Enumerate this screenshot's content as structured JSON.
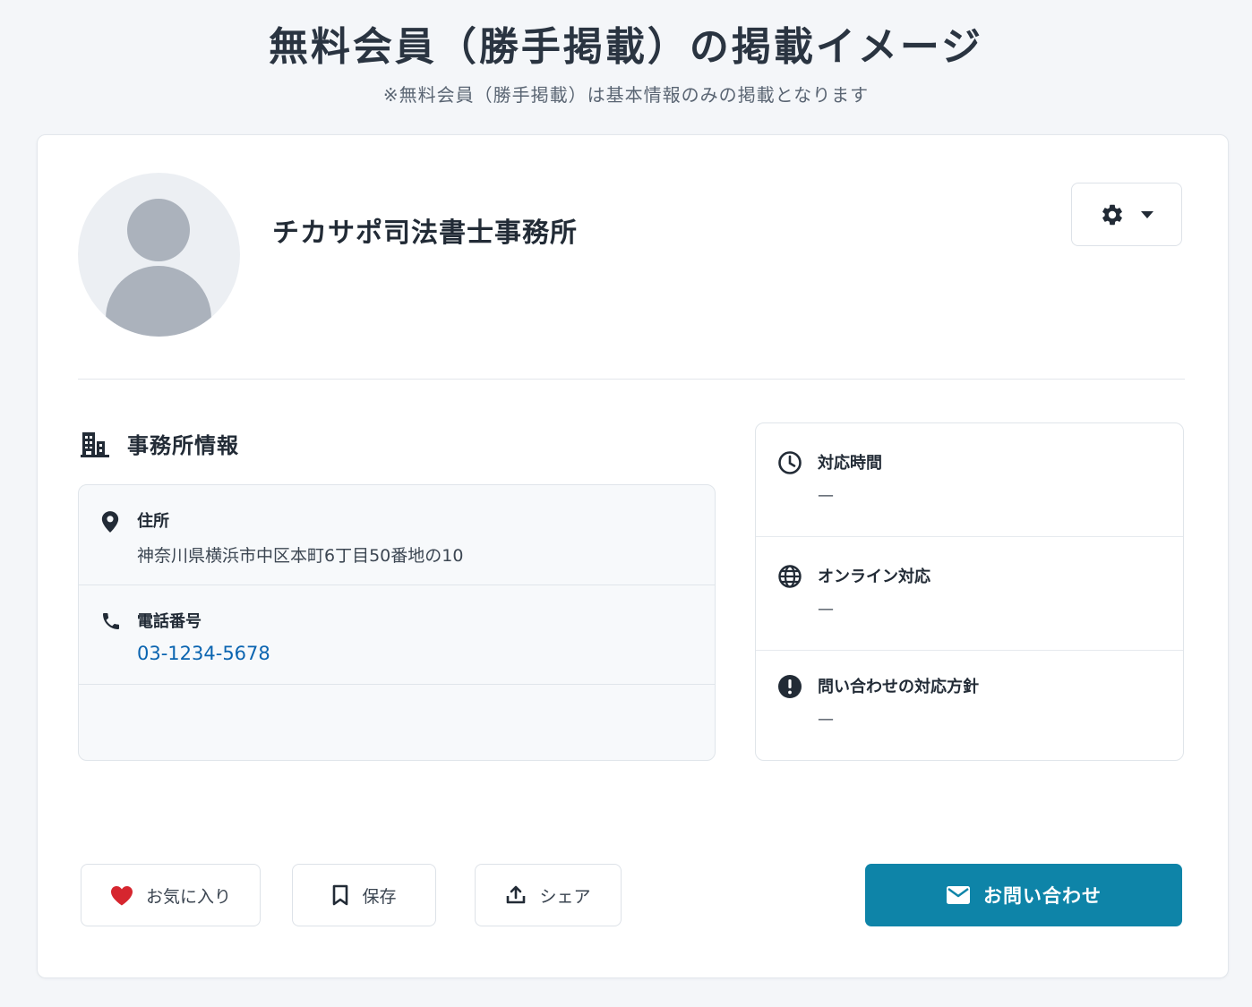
{
  "page": {
    "title": "無料会員（勝手掲載）の掲載イメージ",
    "subtitle": "※無料会員（勝手掲載）は基本情報のみの掲載となります"
  },
  "profile": {
    "office_name": "チカサポ司法書士事務所"
  },
  "office_info": {
    "section_title": "事務所情報",
    "address_label": "住所",
    "address_value": "神奈川県横浜市中区本町6丁目50番地の10",
    "phone_label": "電話番号",
    "phone_value": "03-1234-5678"
  },
  "side_info": {
    "items": [
      {
        "label": "対応時間",
        "value": "—",
        "icon": "clock-icon"
      },
      {
        "label": "オンライン対応",
        "value": "—",
        "icon": "globe-icon"
      },
      {
        "label": "問い合わせの対応方針",
        "value": "—",
        "icon": "alert-circle-icon"
      }
    ]
  },
  "actions": {
    "favorite_label": "お気に入り",
    "save_label": "保存",
    "share_label": "シェア",
    "contact_label": "お問い合わせ"
  },
  "colors": {
    "accent": "#0e84a8",
    "link": "#0a64b0",
    "heart": "#d6262f"
  }
}
